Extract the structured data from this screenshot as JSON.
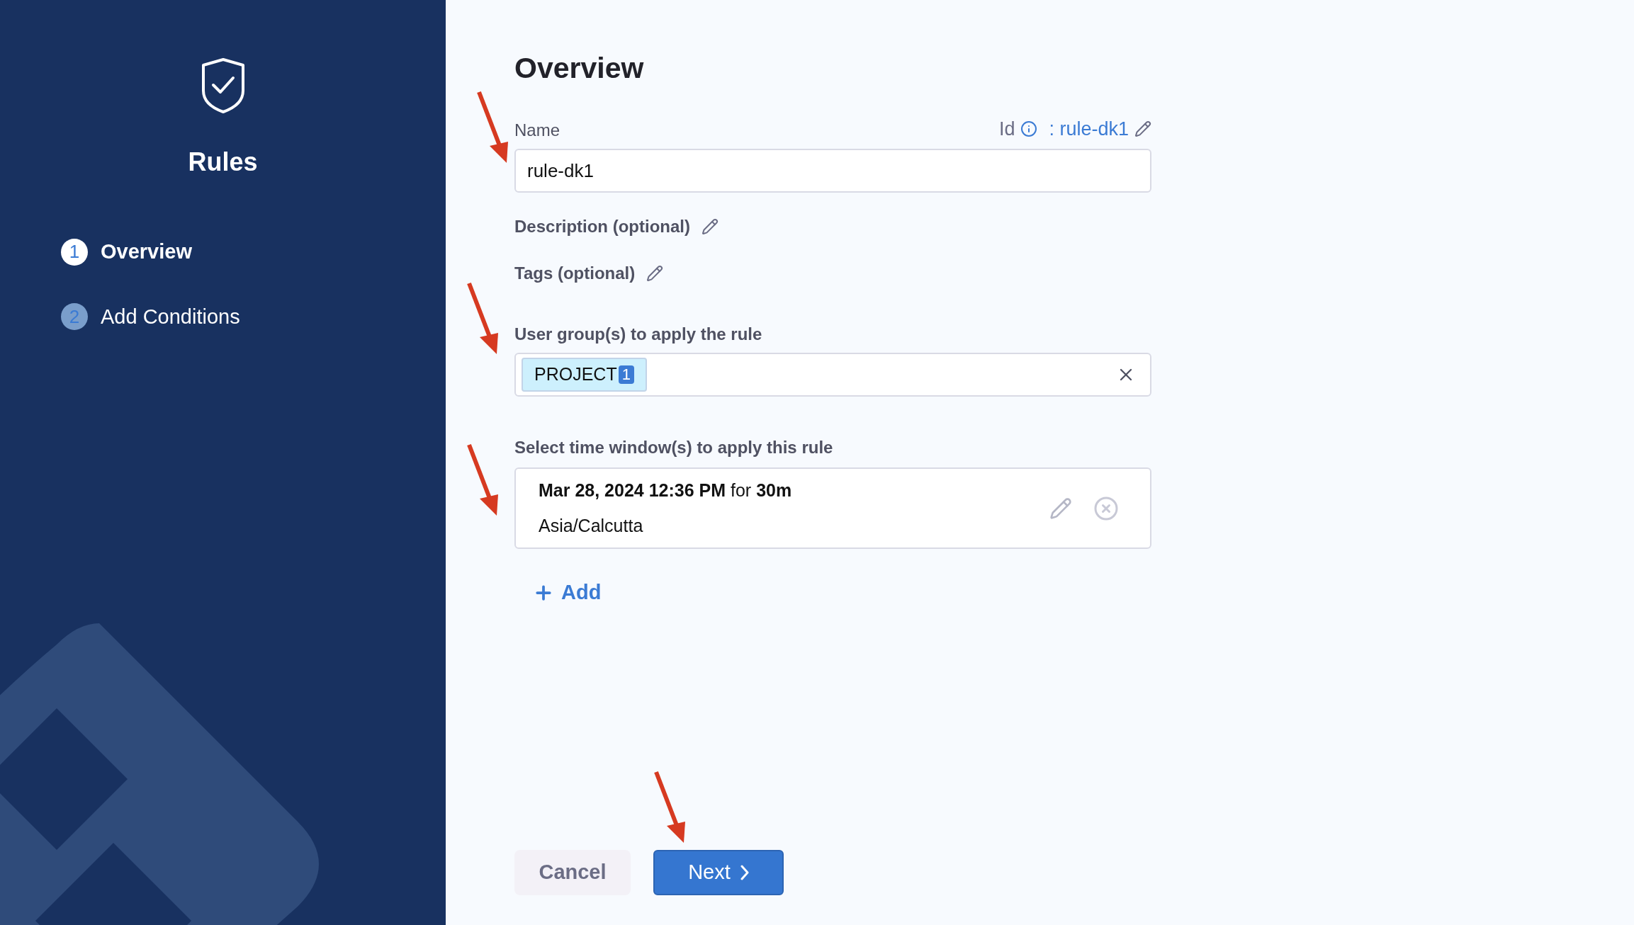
{
  "sidebar": {
    "title": "Rules",
    "steps": [
      {
        "number": "1",
        "label": "Overview",
        "selected": true
      },
      {
        "number": "2",
        "label": "Add Conditions",
        "selected": false
      }
    ]
  },
  "main": {
    "title": "Overview",
    "name_field": {
      "label": "Name",
      "id_label": "Id",
      "id_value": ": rule-dk1",
      "value": "rule-dk1"
    },
    "description_label": "Description (optional)",
    "tags_label": "Tags (optional)",
    "user_groups": {
      "label": "User group(s) to apply the rule",
      "chips": [
        {
          "label": "PROJECT",
          "count": "1"
        }
      ]
    },
    "time_windows": {
      "label": "Select time window(s) to apply this rule",
      "items": [
        {
          "when": "**Mar 28, 2024 12:36 PM** for **30m**",
          "timezone": "Asia/Calcutta"
        }
      ],
      "add_label": "Add"
    },
    "buttons": {
      "cancel": "Cancel",
      "next": "Next"
    }
  }
}
